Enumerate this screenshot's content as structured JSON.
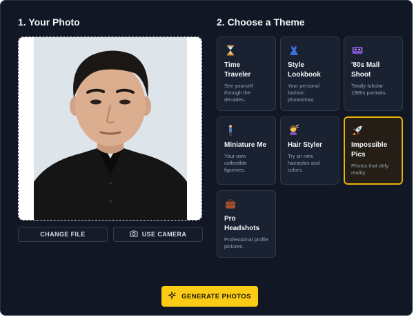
{
  "photo_section": {
    "title": "1. Your Photo",
    "change_file_label": "CHANGE FILE",
    "use_camera_label": "USE CAMERA",
    "camera_icon": "camera-icon"
  },
  "theme_section": {
    "title": "2. Choose a Theme",
    "themes": [
      {
        "title": "Time Traveler",
        "description": "See yourself through the decades.",
        "icon": "hourglass-icon",
        "selected": false
      },
      {
        "title": "Style Lookbook",
        "description": "Your personal fashion photoshoot.",
        "icon": "dress-icon",
        "selected": false
      },
      {
        "title": "'80s Mall Shoot",
        "description": "Totally tubular 1980s portraits.",
        "icon": "cassette-tape-icon",
        "selected": false
      },
      {
        "title": "Miniature Me",
        "description": "Your own collectible figurines.",
        "icon": "figurine-icon",
        "selected": false
      },
      {
        "title": "Hair Styler",
        "description": "Try on new hairstyles and colors.",
        "icon": "haircut-icon",
        "selected": false
      },
      {
        "title": "Impossible Pics",
        "description": "Photos that defy reality.",
        "icon": "rocket-icon",
        "selected": true
      },
      {
        "title": "Pro Headshots",
        "description": "Professional profile pictures.",
        "icon": "briefcase-icon",
        "selected": false
      }
    ]
  },
  "generate_button": {
    "label": "GENERATE PHOTOS",
    "icon": "sparkles-icon"
  },
  "colors": {
    "background": "#111725",
    "card": "#1a2232",
    "accent": "#facc15",
    "selected_border": "#eab308"
  }
}
